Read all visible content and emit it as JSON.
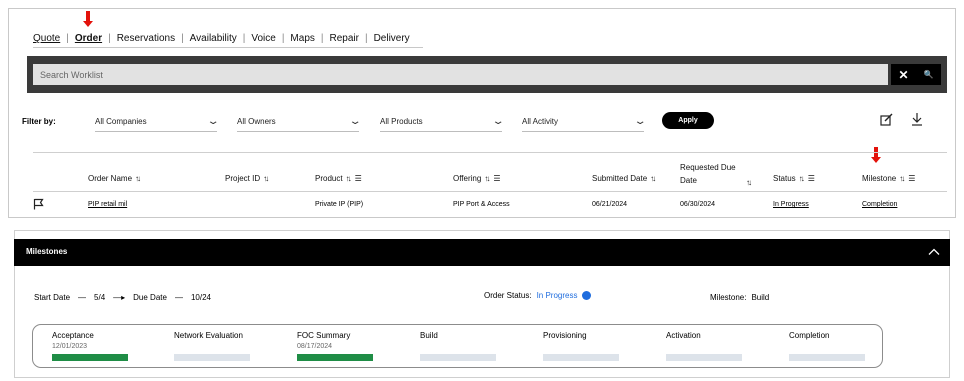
{
  "tabs": [
    {
      "label": "Quote"
    },
    {
      "label": "Order"
    },
    {
      "label": "Reservations"
    },
    {
      "label": "Availability"
    },
    {
      "label": "Voice"
    },
    {
      "label": "Maps"
    },
    {
      "label": "Repair"
    },
    {
      "label": "Delivery"
    }
  ],
  "search": {
    "placeholder": "Search Worklist",
    "clear": "✕",
    "go": "🔍"
  },
  "filters": {
    "label": "Filter by:",
    "dropdowns": [
      "All Companies",
      "All Owners",
      "All Products",
      "All Activity"
    ],
    "apply": "Apply"
  },
  "table": {
    "headers": [
      "Order Name",
      "Project ID",
      "Product",
      "Offering",
      "Submitted Date",
      "Requested Due Date",
      "Status",
      "Milestone"
    ],
    "row": {
      "order_name": "PIP retail mil",
      "project_id": "",
      "product": "Private IP (PIP)",
      "offering": "PIP Port & Access",
      "submitted": "06/21/2024",
      "due": "06/30/2024",
      "status": "In Progress",
      "milestone": "Completion"
    }
  },
  "milestones": {
    "title": "Milestones",
    "start_label": "Start Date",
    "dash": "—",
    "start_value": "5/4",
    "arrow": "—▸",
    "due_label": "Due Date",
    "due_value": "10/24",
    "order_status_label": "Order Status:",
    "order_status_value": "In Progress",
    "milestone_label": "Milestone:",
    "milestone_value": "Build",
    "stages": [
      {
        "name": "Acceptance",
        "date": "12/01/2023",
        "complete": true
      },
      {
        "name": "Network Evaluation",
        "date": "",
        "complete": false
      },
      {
        "name": "FOC Summary",
        "date": "08/17/2024",
        "complete": true
      },
      {
        "name": "Build",
        "date": "",
        "complete": false
      },
      {
        "name": "Provisioning",
        "date": "",
        "complete": false
      },
      {
        "name": "Activation",
        "date": "",
        "complete": false
      },
      {
        "name": "Completion",
        "date": "",
        "complete": false
      }
    ]
  },
  "colors": {
    "complete": "#1f8d46",
    "pending": "#dde3ea",
    "status_blue": "#1f6dde",
    "arrow_red": "#e3120b"
  }
}
